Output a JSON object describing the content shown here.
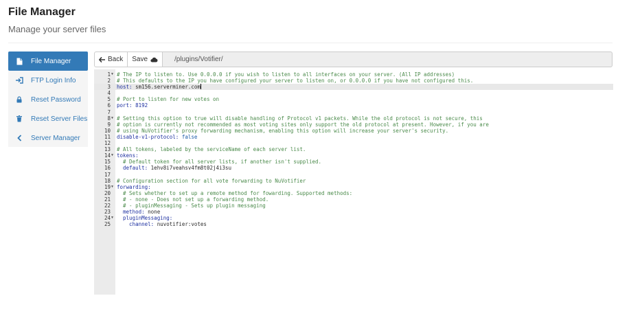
{
  "page": {
    "title": "File Manager",
    "subtitle": "Manage your server files"
  },
  "sidebar": {
    "items": [
      {
        "label": "File Manager",
        "icon": "file-icon",
        "active": true
      },
      {
        "label": "FTP Login Info",
        "icon": "sign-in-icon",
        "active": false
      },
      {
        "label": "Reset Password",
        "icon": "lock-icon",
        "active": false
      },
      {
        "label": "Reset Server Files",
        "icon": "trash-icon",
        "active": false
      },
      {
        "label": "Server Manager",
        "icon": "chevron-left-icon",
        "active": false
      }
    ]
  },
  "toolbar": {
    "back_label": "Back",
    "save_label": "Save",
    "path": "/plugins/Votifier/"
  },
  "colors": {
    "accent": "#337ab7",
    "comment": "#4a8a4a",
    "key": "#1c2fa0"
  },
  "editor": {
    "lines": [
      {
        "num": "1",
        "fold": true,
        "parts": [
          {
            "t": "# The IP to listen to. Use 0.0.0.0 if you wish to listen to all interfaces on your server. (All IP addresses)",
            "c": "comment"
          }
        ]
      },
      {
        "num": "2",
        "parts": [
          {
            "t": "# This defaults to the IP you have configured your server to listen on, or 0.0.0.0 if you have not configured this.",
            "c": "comment"
          }
        ]
      },
      {
        "num": "3",
        "highlight": true,
        "cursor": true,
        "parts": [
          {
            "t": "host:",
            "c": "key"
          },
          {
            "t": " sm156.serverminer.com",
            "c": "val"
          }
        ]
      },
      {
        "num": "4",
        "parts": []
      },
      {
        "num": "5",
        "parts": [
          {
            "t": "# Port to listen for new votes on",
            "c": "comment"
          }
        ]
      },
      {
        "num": "6",
        "parts": [
          {
            "t": "port:",
            "c": "key"
          },
          {
            "t": " 8192",
            "c": "num"
          }
        ]
      },
      {
        "num": "7",
        "parts": []
      },
      {
        "num": "8",
        "fold": true,
        "parts": [
          {
            "t": "# Setting this option to true will disable handling of Protocol v1 packets. While the old protocol is not secure, this",
            "c": "comment"
          }
        ]
      },
      {
        "num": "9",
        "parts": [
          {
            "t": "# option is currently not recommended as most voting sites only support the old protocol at present. However, if you are",
            "c": "comment"
          }
        ]
      },
      {
        "num": "10",
        "parts": [
          {
            "t": "# using NuVotifier's proxy forwarding mechanism, enabling this option will increase your server's security.",
            "c": "comment"
          }
        ]
      },
      {
        "num": "11",
        "parts": [
          {
            "t": "disable-v1-protocol:",
            "c": "key"
          },
          {
            "t": " false",
            "c": "kw"
          }
        ]
      },
      {
        "num": "12",
        "parts": []
      },
      {
        "num": "13",
        "parts": [
          {
            "t": "# All tokens, labeled by the serviceName of each server list.",
            "c": "comment"
          }
        ]
      },
      {
        "num": "14",
        "fold": true,
        "parts": [
          {
            "t": "tokens:",
            "c": "key"
          }
        ]
      },
      {
        "num": "15",
        "parts": [
          {
            "t": "  # Default token for all server lists, if another isn't supplied.",
            "c": "comment"
          }
        ]
      },
      {
        "num": "16",
        "parts": [
          {
            "t": "  default:",
            "c": "key"
          },
          {
            "t": " 1ehv8i7veahsv4fm8t02j4i3su",
            "c": "val"
          }
        ]
      },
      {
        "num": "17",
        "parts": []
      },
      {
        "num": "18",
        "parts": [
          {
            "t": "# Configuration section for all vote forwarding to NuVotifier",
            "c": "comment"
          }
        ]
      },
      {
        "num": "19",
        "fold": true,
        "parts": [
          {
            "t": "forwarding:",
            "c": "key"
          }
        ]
      },
      {
        "num": "20",
        "parts": [
          {
            "t": "  # Sets whether to set up a remote method for fowarding. Supported methods:",
            "c": "comment"
          }
        ]
      },
      {
        "num": "21",
        "parts": [
          {
            "t": "  # - none - Does not set up a forwarding method.",
            "c": "comment"
          }
        ]
      },
      {
        "num": "22",
        "parts": [
          {
            "t": "  # - pluginMessaging - Sets up plugin messaging",
            "c": "comment"
          }
        ]
      },
      {
        "num": "23",
        "parts": [
          {
            "t": "  method:",
            "c": "key"
          },
          {
            "t": " none",
            "c": "val"
          }
        ]
      },
      {
        "num": "24",
        "fold": true,
        "parts": [
          {
            "t": "  pluginMessaging:",
            "c": "key"
          }
        ]
      },
      {
        "num": "25",
        "parts": [
          {
            "t": "    channel:",
            "c": "key"
          },
          {
            "t": " nuvotifier:votes",
            "c": "val"
          }
        ]
      }
    ]
  }
}
